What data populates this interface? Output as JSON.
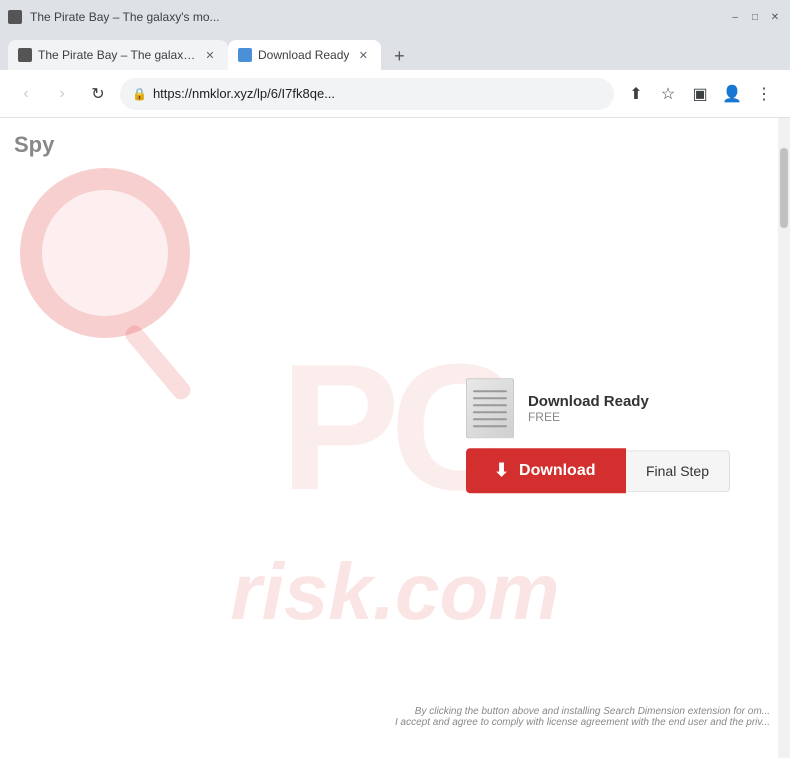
{
  "browser": {
    "title_bar": {
      "minimize_label": "–",
      "maximize_label": "□",
      "close_label": "✕"
    },
    "tabs": [
      {
        "id": "tab-pirate",
        "title": "The Pirate Bay – The galaxy's mo...",
        "favicon_type": "pirate",
        "active": false
      },
      {
        "id": "tab-download",
        "title": "Download Ready",
        "favicon_type": "download",
        "active": true
      }
    ],
    "new_tab_label": "+",
    "nav": {
      "back_label": "‹",
      "forward_label": "›",
      "reload_label": "↻",
      "address": "https://nmklor.xyz/lp/6/I7fk8qe...",
      "lock_icon": "🔒"
    }
  },
  "webpage": {
    "spy_logo": "Spy",
    "pc_watermark": "PC",
    "risk_watermark": "risk.com",
    "download_ready": {
      "label": "Download Ready",
      "free_label": "FREE"
    },
    "download_button": {
      "label": "Download",
      "icon": "⬇"
    },
    "final_step_button": {
      "label": "Final Step"
    },
    "disclaimer": {
      "line1": "By clicking the button above and installing Search Dimension extension for om...",
      "line2": "I accept and agree to comply with license agreement with the end user and the priv..."
    }
  }
}
